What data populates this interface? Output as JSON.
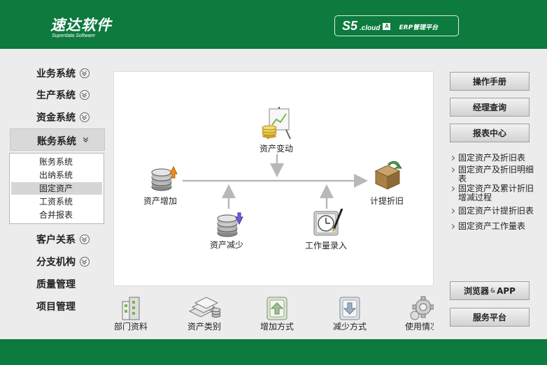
{
  "header": {
    "logo_cn": "速达软件",
    "logo_en": "Superdata Software",
    "product_s5": "S5",
    "product_cloud": ".cloud",
    "product_badge": "A",
    "product_erp": "ERP管理平台"
  },
  "sidebar": {
    "items": [
      {
        "label": "业务系统"
      },
      {
        "label": "生产系统"
      },
      {
        "label": "资金系统"
      },
      {
        "label": "账务系统"
      },
      {
        "label": "客户关系"
      },
      {
        "label": "分支机构"
      },
      {
        "label": "质量管理"
      },
      {
        "label": "项目管理"
      }
    ],
    "submenu": [
      "账务系统",
      "出纳系统",
      "固定资产",
      "工资系统",
      "合并报表"
    ],
    "selected_submenu": "固定资产"
  },
  "flow": {
    "asset_change": "资产变动",
    "asset_add": "资产增加",
    "asset_reduce": "资产减少",
    "workload_entry": "工作量录入",
    "depreciation": "计提折旧"
  },
  "bottom_icons": [
    "部门资料",
    "资产类别",
    "增加方式",
    "减少方式",
    "使用情况"
  ],
  "right": {
    "manual": "操作手册",
    "manager_query": "经理查询",
    "report_center": "报表中心",
    "reports": [
      "固定资产及折旧表",
      "固定资产及折旧明细表",
      "固定资产及累计折旧增减过程",
      "固定资产计提折旧表",
      "固定资产工作量表"
    ],
    "browser_app_1": "浏览器",
    "browser_app_amp": "&",
    "browser_app_2": "APP",
    "service_platform": "服务平台"
  },
  "colors": {
    "brand_green": "#0d7a3e",
    "background": "#ececec",
    "panel": "#ffffff"
  }
}
